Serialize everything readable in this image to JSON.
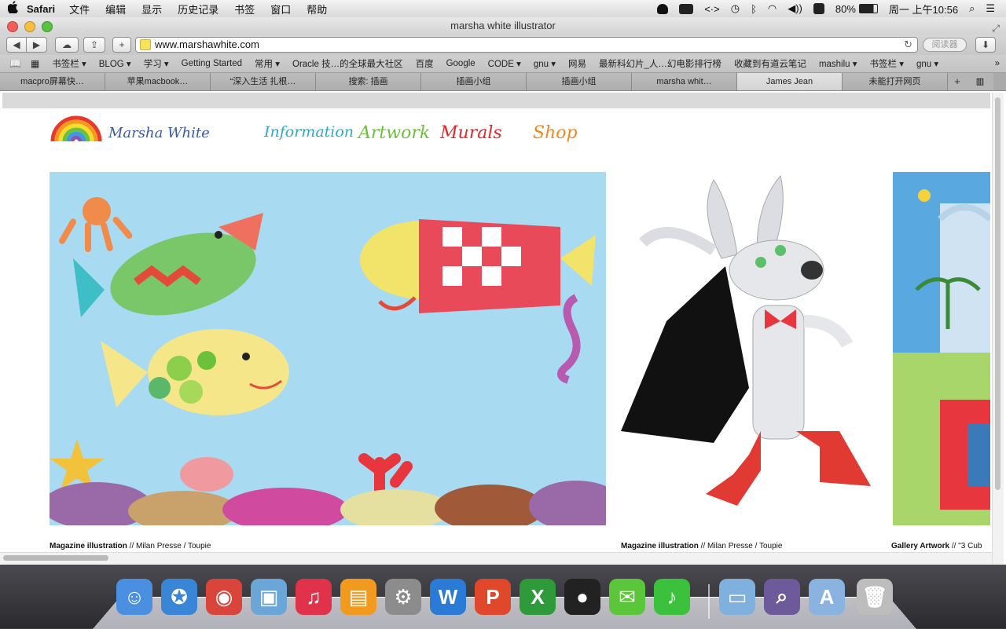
{
  "menubar": {
    "apple": "",
    "app_name": "Safari",
    "menus": [
      "文件",
      "编辑",
      "显示",
      "历史记录",
      "书签",
      "窗口",
      "帮助"
    ],
    "battery": "80%",
    "clock": "周一 上午10:56"
  },
  "window": {
    "title": "marsha white illustrator",
    "url": "www.marshawhite.com",
    "reader_label": "阅读器",
    "add_label": "+"
  },
  "bookmarks": [
    "书签栏 ▾",
    "BLOG ▾",
    "学习 ▾",
    "Getting Started",
    "常用 ▾",
    "Oracle 技…的全球最大社区",
    "百度",
    "Google",
    "CODE ▾",
    "gnu ▾",
    "网易",
    "最新科幻片_人…幻电影排行榜",
    "收藏到有道云笔记",
    "mashilu ▾",
    "书签栏 ▾",
    "gnu ▾"
  ],
  "tabs": [
    {
      "label": "macpro屏幕快…",
      "active": false
    },
    {
      "label": "苹果macbook…",
      "active": false
    },
    {
      "label": "“深入生活 扎根…",
      "active": false
    },
    {
      "label": "搜索: 插画",
      "active": false
    },
    {
      "label": "插画小组",
      "active": false
    },
    {
      "label": "插画小组",
      "active": false
    },
    {
      "label": "marsha whit…",
      "active": false
    },
    {
      "label": "James Jean",
      "active": true
    },
    {
      "label": "未能打开网页",
      "active": false
    }
  ],
  "site": {
    "logo_text": "Marsha White",
    "nav": [
      {
        "label": "Information",
        "color": "#2fa8c8"
      },
      {
        "label": "Artwork",
        "color": "#6cc13a"
      },
      {
        "label": "Murals",
        "color": "#e3262b"
      },
      {
        "label": "Shop",
        "color": "#f08a1c"
      }
    ],
    "captions": [
      {
        "title": "Magazine illustration",
        "detail": " // Milan Presse / Toupie"
      },
      {
        "title": "Magazine illustration",
        "detail": " // Milan Presse / Toupie"
      },
      {
        "title": "Gallery Artwork",
        "detail": " // \"3 Cub"
      }
    ]
  },
  "dock": [
    {
      "name": "finder-icon",
      "glyph": "☺",
      "color": "#4a8fe0"
    },
    {
      "name": "safari-icon",
      "glyph": "✪",
      "color": "#3a86d6"
    },
    {
      "name": "chrome-icon",
      "glyph": "◉",
      "color": "#d9453a"
    },
    {
      "name": "iphoto-icon",
      "glyph": "▣",
      "color": "#6aa6d8"
    },
    {
      "name": "itunes-icon",
      "glyph": "♫",
      "color": "#e0324a"
    },
    {
      "name": "ibooks-icon",
      "glyph": "▤",
      "color": "#f29a1e"
    },
    {
      "name": "system-preferences-icon",
      "glyph": "⚙",
      "color": "#8c8c8c"
    },
    {
      "name": "word-icon",
      "glyph": "W",
      "color": "#2a7ad6"
    },
    {
      "name": "powerpoint-icon",
      "glyph": "P",
      "color": "#e0472b"
    },
    {
      "name": "excel-icon",
      "glyph": "X",
      "color": "#2f9a3a"
    },
    {
      "name": "qq-icon",
      "glyph": "●",
      "color": "#222222"
    },
    {
      "name": "wechat-icon",
      "glyph": "✉",
      "color": "#5bc63a"
    },
    {
      "name": "music-icon",
      "glyph": "♪",
      "color": "#3cc13c"
    },
    {
      "name": "folder-icon",
      "glyph": "▭",
      "color": "#7fb0de"
    },
    {
      "name": "preview-icon",
      "glyph": "⌕",
      "color": "#6c5a9a"
    },
    {
      "name": "applications-folder-icon",
      "glyph": "A",
      "color": "#8ab3df"
    },
    {
      "name": "trash-icon",
      "glyph": "🗑",
      "color": "#bdbdbd"
    }
  ]
}
